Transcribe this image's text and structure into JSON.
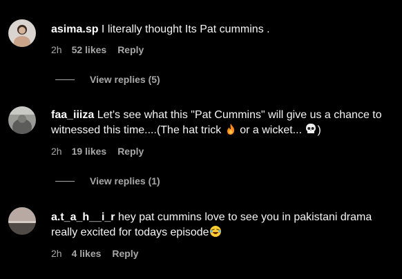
{
  "comments": [
    {
      "username": "asima.sp",
      "text": " I literally thought Its Pat cummins .",
      "time": "2h",
      "likes": "52 likes",
      "reply_label": "Reply",
      "view_replies": "View replies (5)"
    },
    {
      "username": "faa_iiiza",
      "text_part1": " Let's see what this \"Pat Cummins\" will give us a chance to witnessed this time....(The hat trick",
      "text_part2": " or a wicket...",
      "text_part3": ")",
      "time": "2h",
      "likes": "19 likes",
      "reply_label": "Reply",
      "view_replies": "View replies (1)"
    },
    {
      "username": "a.t_a_h__i_r",
      "text": " hey pat cummins love to see you in pakistani drama really excited for todays episode",
      "time": "2h",
      "likes": "4 likes",
      "reply_label": "Reply"
    }
  ],
  "icons": [
    "fire-emoji-icon",
    "skull-emoji-icon",
    "laughing-emoji-icon"
  ]
}
